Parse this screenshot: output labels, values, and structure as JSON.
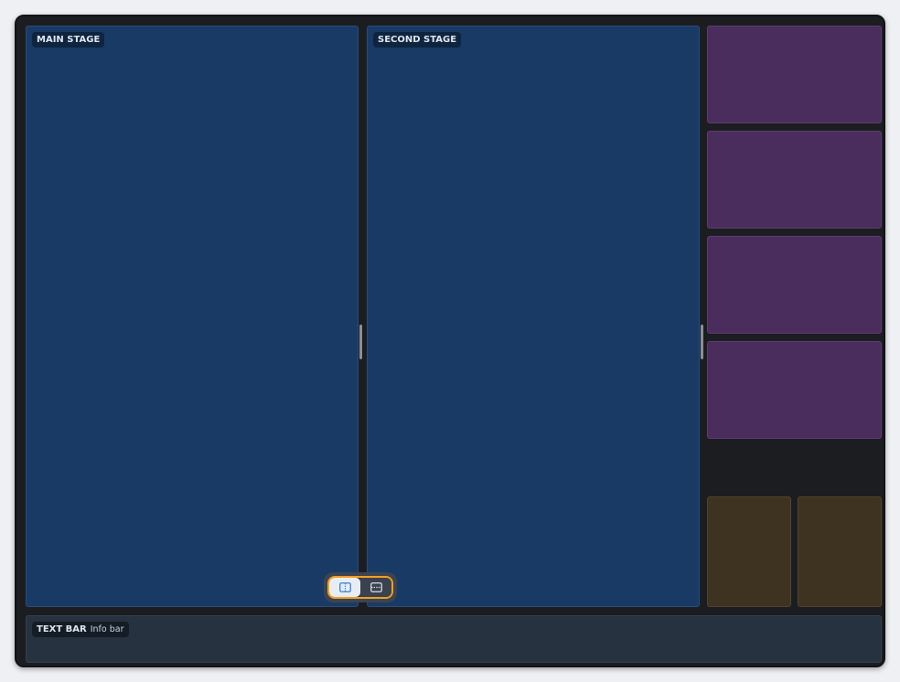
{
  "stages": {
    "main": {
      "label": "MAIN STAGE"
    },
    "second": {
      "label": "SECOND STAGE"
    }
  },
  "text_bar": {
    "label": "TEXT BAR",
    "sublabel": "Info bar"
  },
  "layout_toggle": {
    "options": [
      {
        "icon": "split-vertical-icon",
        "active": true
      },
      {
        "icon": "split-horizontal-icon",
        "active": false
      }
    ]
  },
  "colors": {
    "stage": "#193a64",
    "side_tile": "#4a2d5c",
    "small_tile": "#3e3220",
    "text_bar": "#26323f",
    "toggle_highlight": "#f0a020"
  }
}
